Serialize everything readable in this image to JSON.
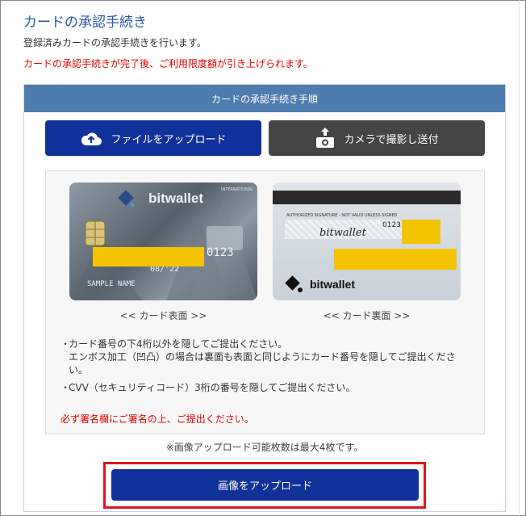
{
  "page": {
    "title": "カードの承認手続き",
    "description": "登録済みカードの承認手続きを行います。",
    "notice": "カードの承認手続きが完了後、ご利用限度額が引き上げられます。"
  },
  "panel": {
    "header": "カードの承認手続き手順",
    "upload_file_label": "ファイルをアップロード",
    "camera_label": "カメラで撮影し送付"
  },
  "cards": {
    "front": {
      "brand": "bitwallet",
      "network": "INTERNATIONAL",
      "number_tail": "0123",
      "expiry": "08/'22",
      "holder": "SAMPLE NAME",
      "caption": "<< カード表面 >>"
    },
    "back": {
      "signature_label": "AUTHORIZED SIGNATURE - NOT VALID UNLESS SIGNED",
      "signature": "bitwallet",
      "number_tail": "0123",
      "brand": "bitwallet",
      "caption": "<< カード裏面 >>"
    }
  },
  "instructions": [
    {
      "lines": [
        "カード番号の下4桁以外を隠してご提出ください。",
        "エンボス加工（凹凸）の場合は裏面も表面と同じようにカード番号を隠してご提出くださ",
        "い。"
      ]
    },
    {
      "lines": [
        "CVV（セキュリティコード）3桁の番号を隠してご提出ください。"
      ]
    }
  ],
  "signature_note": "必ず署名欄にご署名の上、ご提出ください。",
  "limit_note": "※画像アップロード可能枚数は最大4枚です。",
  "upload_button": "画像をアップロード",
  "colors": {
    "title": "#2b58a6",
    "notice": "#e00000",
    "header": "#4f7cae",
    "primary": "#11319a",
    "camera": "#454545",
    "mask": "#f5c400",
    "highlight": "#e0141e"
  }
}
